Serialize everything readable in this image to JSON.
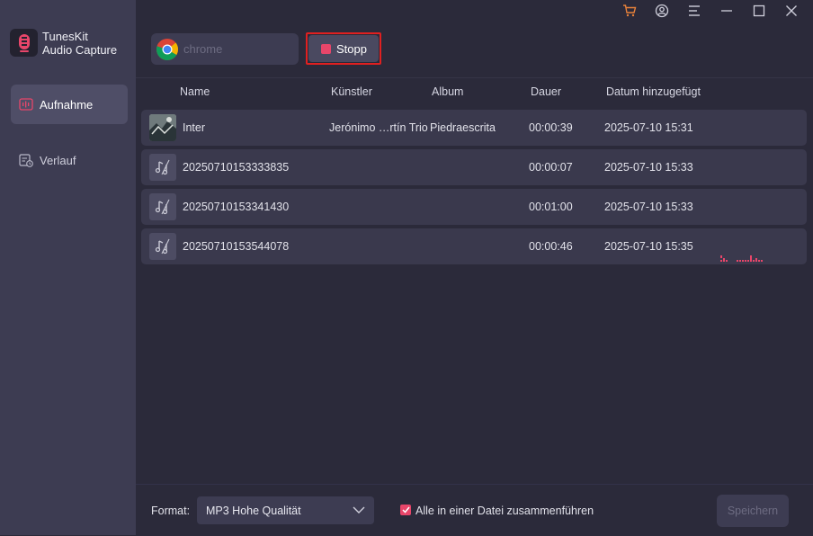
{
  "app": {
    "name_line1": "TunesKit",
    "name_line2": "Audio Capture"
  },
  "sidebar": {
    "items": [
      {
        "label": "Aufnahme",
        "icon": "record-wave-icon",
        "active": true
      },
      {
        "label": "Verlauf",
        "icon": "history-icon",
        "active": false
      }
    ]
  },
  "titlebar": {
    "icons": [
      "cart-icon",
      "account-icon",
      "menu-icon",
      "minimize-icon",
      "maximize-icon",
      "close-icon"
    ],
    "cart_color": "#e8813a"
  },
  "toolbar": {
    "source_placeholder": "chrome",
    "stop_label": "Stopp"
  },
  "table": {
    "headers": {
      "name": "Name",
      "artist": "Künstler",
      "album": "Album",
      "duration": "Dauer",
      "date_added": "Datum hinzugefügt"
    },
    "rows": [
      {
        "name": "Inter",
        "artist": "Jerónimo …rtín Trio",
        "album": "Piedraescrita",
        "duration": "00:00:39",
        "date": "2025-07-10 15:31",
        "has_art": true
      },
      {
        "name": "20250710153333835",
        "artist": "",
        "album": "",
        "duration": "00:00:07",
        "date": "2025-07-10 15:33",
        "has_art": false
      },
      {
        "name": "20250710153341430",
        "artist": "",
        "album": "",
        "duration": "00:01:00",
        "date": "2025-07-10 15:33",
        "has_art": false
      },
      {
        "name": "20250710153544078",
        "artist": "",
        "album": "",
        "duration": "00:00:46",
        "date": "2025-07-10 15:35",
        "has_art": false
      }
    ]
  },
  "footer": {
    "format_label": "Format:",
    "format_value": "MP3 Hohe Qualität",
    "merge_label": "Alle in einer Datei zusammenführen",
    "merge_checked": true,
    "save_label": "Speichern"
  },
  "colors": {
    "accent": "#e8466a",
    "sidebar_bg": "#3d3c52",
    "main_bg": "#2b2a3a",
    "row_bg": "#3a394d",
    "highlight_border": "#e02020"
  }
}
